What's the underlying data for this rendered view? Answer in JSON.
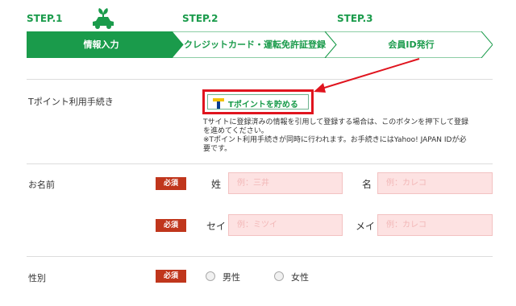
{
  "steps": [
    {
      "step": "STEP.1",
      "label": "情報入力"
    },
    {
      "step": "STEP.2",
      "label": "クレジットカード・運転免許証登録"
    },
    {
      "step": "STEP.3",
      "label": "会員ID発行"
    }
  ],
  "colors": {
    "brand": "#1a9b4b",
    "required": "#c0361c",
    "input_bg": "#fde2e2",
    "highlight": "#e0141e"
  },
  "tpoint": {
    "row_label": "Tポイント利用手続き",
    "button_label": "Tポイントを貯める",
    "note_line1": "Tサイトに登録済みの情報を引用して登録する場合は、このボタンを押下して登録",
    "note_line2": "を進めてください。",
    "note_line3": "※Tポイント利用手続きが同時に行われます。お手続きにはYahoo! JAPAN IDが必",
    "note_line4": "要です。"
  },
  "name": {
    "row_label": "お名前",
    "required": "必須",
    "sei_label": "姓",
    "sei_placeholder": "例：三井",
    "mei_label": "名",
    "mei_placeholder": "例：カレコ",
    "sei_kana_label": "セイ",
    "sei_kana_placeholder": "例：ミツイ",
    "mei_kana_label": "メイ",
    "mei_kana_placeholder": "例：カレコ"
  },
  "gender": {
    "row_label": "性別",
    "required": "必須",
    "options": [
      "男性",
      "女性"
    ]
  }
}
